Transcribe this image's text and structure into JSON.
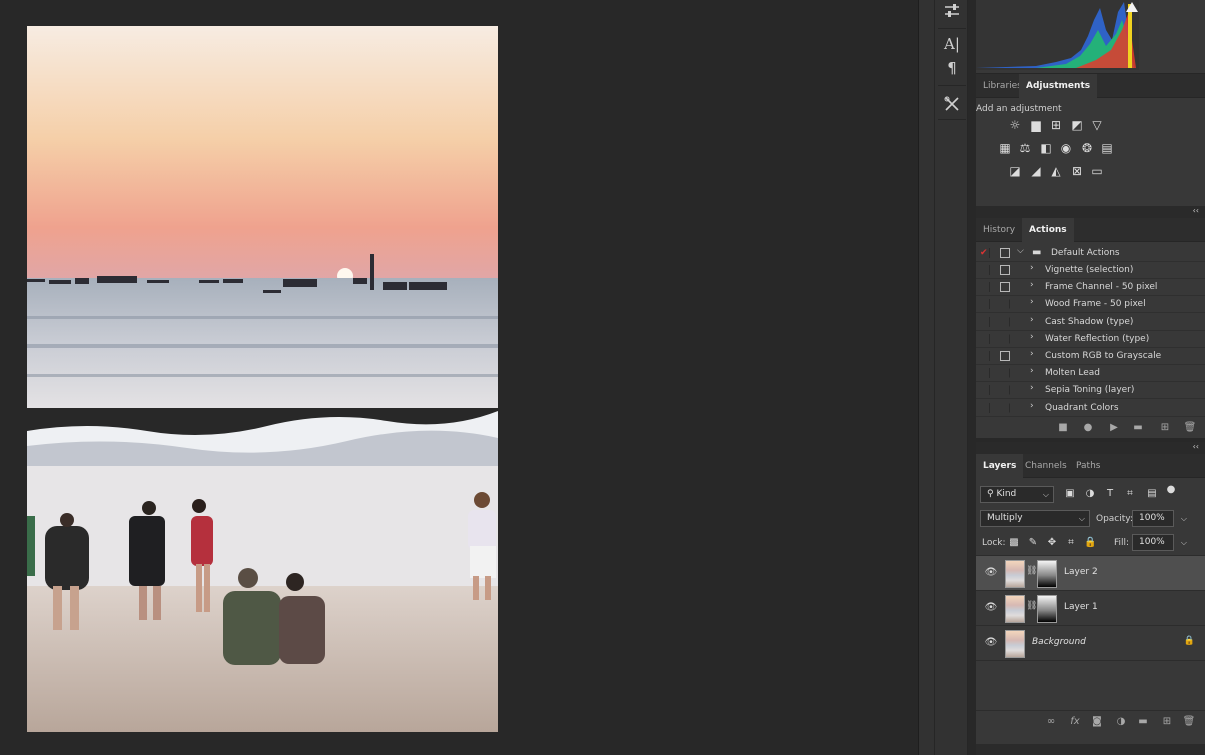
{
  "canvas": {
    "description_image": "beach-sunset"
  },
  "toolbar": {
    "icons": [
      "sliders-icon",
      "character-icon",
      "paragraph-icon",
      "tools-icon"
    ]
  },
  "adjustments_panel": {
    "tabs": [
      {
        "label": "Libraries",
        "active": false
      },
      {
        "label": "Adjustments",
        "active": true
      }
    ],
    "title": "Add an adjustment",
    "icons_row1": [
      "brightness-icon",
      "levels-icon",
      "curves-icon",
      "exposure-icon",
      "vibrance-icon"
    ],
    "icons_row2": [
      "hue-saturation-icon",
      "color-balance-icon",
      "black-white-icon",
      "photo-filter-icon",
      "channel-mixer-icon",
      "color-lookup-icon"
    ],
    "icons_row3": [
      "invert-icon",
      "posterize-icon",
      "threshold-icon",
      "selective-color-icon",
      "gradient-map-icon"
    ]
  },
  "actions_panel": {
    "tabs": [
      {
        "label": "History",
        "active": false
      },
      {
        "label": "Actions",
        "active": true
      }
    ],
    "set": {
      "label": "Default Actions",
      "checked": true
    },
    "items": [
      {
        "label": "Vignette (selection)",
        "dialog": true
      },
      {
        "label": "Frame Channel - 50 pixel",
        "dialog": true
      },
      {
        "label": "Wood Frame - 50 pixel",
        "dialog": false
      },
      {
        "label": "Cast Shadow (type)",
        "dialog": false
      },
      {
        "label": "Water Reflection (type)",
        "dialog": false
      },
      {
        "label": "Custom RGB to Grayscale",
        "dialog": true
      },
      {
        "label": "Molten Lead",
        "dialog": false
      },
      {
        "label": "Sepia Toning (layer)",
        "dialog": false
      },
      {
        "label": "Quadrant Colors",
        "dialog": false
      }
    ]
  },
  "layers_panel": {
    "tabs": [
      {
        "label": "Layers",
        "active": true
      },
      {
        "label": "Channels",
        "active": false
      },
      {
        "label": "Paths",
        "active": false
      }
    ],
    "filter": {
      "label": "Kind"
    },
    "blend_mode": "Multiply",
    "opacity_label": "Opacity:",
    "opacity_value": "100%",
    "lock_label": "Lock:",
    "fill_label": "Fill:",
    "fill_value": "100%",
    "layers": [
      {
        "name": "Layer 2",
        "selected": true,
        "mask": true
      },
      {
        "name": "Layer 1",
        "selected": false,
        "mask": true
      },
      {
        "name": "Background",
        "selected": false,
        "mask": false,
        "locked": true
      }
    ]
  }
}
